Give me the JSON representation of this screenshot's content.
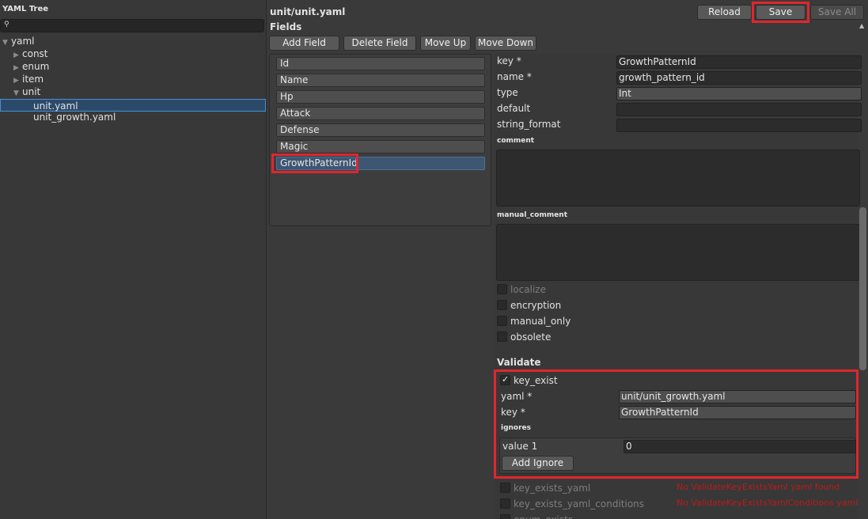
{
  "tree": {
    "title": "YAML Tree",
    "search_icon": "magnifier-icon",
    "nodes": [
      {
        "label": "yaml",
        "arrow": "▼"
      },
      {
        "label": "const",
        "arrow": "▶"
      },
      {
        "label": "enum",
        "arrow": "▶"
      },
      {
        "label": "item",
        "arrow": "▶"
      },
      {
        "label": "unit",
        "arrow": "▼"
      },
      {
        "label": "unit.yaml",
        "arrow": ""
      },
      {
        "label": "unit_growth.yaml",
        "arrow": ""
      }
    ]
  },
  "header": {
    "path": "unit/unit.yaml",
    "reload": "Reload",
    "save": "Save",
    "save_all": "Save All"
  },
  "fields": {
    "label": "Fields",
    "add": "Add Field",
    "delete": "Delete Field",
    "move_up": "Move Up",
    "move_down": "Move Down",
    "items": [
      "Id",
      "Name",
      "Hp",
      "Attack",
      "Defense",
      "Magic",
      "GrowthPatternId"
    ]
  },
  "props": {
    "key_label": "key *",
    "key_value": "GrowthPatternId",
    "name_label": "name *",
    "name_value": "growth_pattern_id",
    "type_label": "type",
    "type_value": "Int",
    "default_label": "default",
    "default_value": "",
    "string_format_label": "string_format",
    "string_format_value": "",
    "comment_label": "comment",
    "manual_comment_label": "manual_comment",
    "localize": "localize",
    "encryption": "encryption",
    "manual_only": "manual_only",
    "obsolete": "obsolete"
  },
  "validate": {
    "title": "Validate",
    "key_exist": "key_exist",
    "yaml_label": "yaml *",
    "yaml_value": "unit/unit_growth.yaml",
    "key_label": "key *",
    "key_value": "GrowthPatternId",
    "ignores_label": "ignores",
    "value1_label": "value 1",
    "value1_value": "0",
    "add_ignore": "Add Ignore",
    "key_exists_yaml": "key_exists_yaml",
    "key_exists_yaml_conditions": "key_exists_yaml_conditions",
    "enum_exists": "enum_exists",
    "err1": "No ValidateKeyExistsYaml yaml found",
    "err2": "No ValidateKeyExistsYamlConditions yaml"
  }
}
